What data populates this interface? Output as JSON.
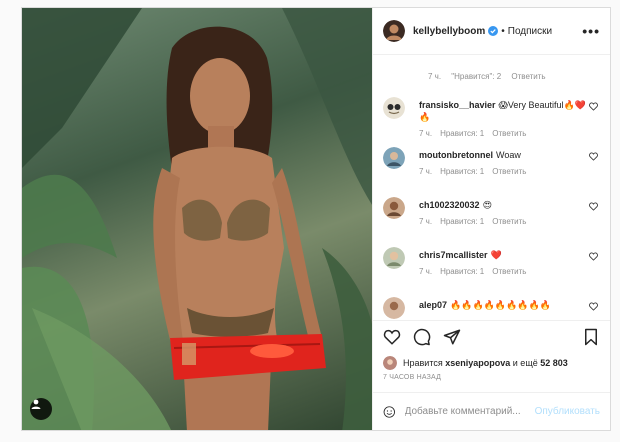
{
  "post": {
    "author": "kellybellyboom",
    "follow_label": "Подписки",
    "separator": "•",
    "more_label": "•••",
    "top_meta": {
      "time": "7 ч.",
      "likes": "\"Нравится\": 2",
      "reply": "Ответить"
    },
    "comments": [
      {
        "user": "fransisko__havier",
        "text": "😱Very Beautiful🔥❤️🔥",
        "time": "7 ч.",
        "likes": "Нравится: 1",
        "reply": "Ответить"
      },
      {
        "user": "moutonbretonnel",
        "text": "Woaw",
        "time": "7 ч.",
        "likes": "Нравится: 1",
        "reply": "Ответить"
      },
      {
        "user": "ch1002320032",
        "text": "😍",
        "time": "7 ч.",
        "likes": "Нравится: 1",
        "reply": "Ответить"
      },
      {
        "user": "chris7mcallister",
        "text": "❤️",
        "time": "7 ч.",
        "likes": "Нравится: 1",
        "reply": "Ответить"
      },
      {
        "user": "alep07",
        "text": "🔥🔥🔥🔥🔥🔥🔥🔥🔥",
        "time": "",
        "likes": "",
        "reply": ""
      }
    ],
    "likes_line": {
      "prefix": "Нравится",
      "user": "xseniyapopova",
      "middle": "и ещё",
      "count": "52 803"
    },
    "time_ago": "7 ЧАСОВ НАЗАД",
    "add_comment": {
      "placeholder": "Добавьте комментарий...",
      "publish_label": "Опубликовать"
    }
  },
  "icons": {
    "verified": "verified-badge-icon",
    "like": "heart-icon",
    "comment": "comment-bubble-icon",
    "share": "paper-plane-icon",
    "save": "bookmark-icon",
    "emoji": "smiley-icon",
    "user_tag": "user-tag-icon"
  },
  "colors": {
    "verified": "#3897f0",
    "publish_disabled": "#b2dffc",
    "muted_text": "#8e8e8e",
    "heart_red": "#ed4956"
  }
}
